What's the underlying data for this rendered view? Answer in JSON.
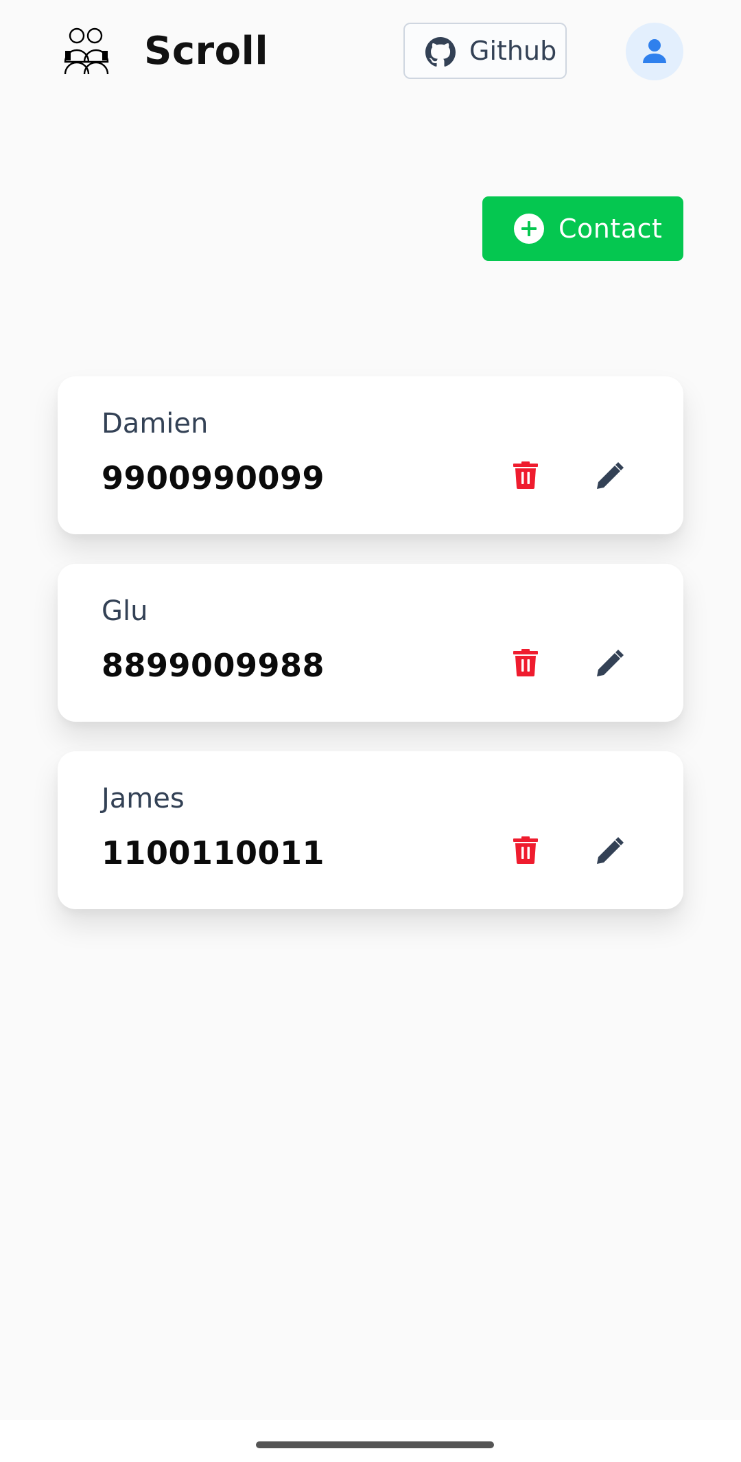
{
  "app": {
    "title": "Scroll"
  },
  "header": {
    "github_label": "Github",
    "icons": {
      "logo": "people-group-icon",
      "github": "github-icon",
      "avatar": "user-icon"
    }
  },
  "actions": {
    "add_contact_label": "Contact",
    "add_icon": "plus-circle-icon"
  },
  "contacts": [
    {
      "name": "Damien",
      "phone": "9900990099"
    },
    {
      "name": "Glu",
      "phone": "8899009988"
    },
    {
      "name": "James",
      "phone": "1100110011"
    }
  ],
  "colors": {
    "accent_green": "#05c750",
    "delete_red": "#ef1c2e",
    "edit_dark": "#334155",
    "avatar_blue": "#2f80ed",
    "avatar_bg": "#e3effd"
  }
}
